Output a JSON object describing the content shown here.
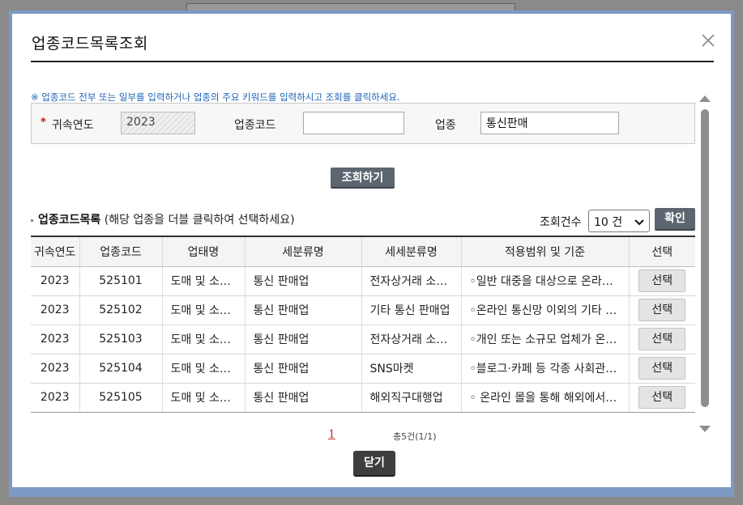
{
  "modal": {
    "title": "업종코드목록조회",
    "close_icon": "close-icon",
    "notice": "※ 업종코드 전부 또는 일부를 입력하거나 업종의 주요 키워드를 입력하시고 조회를 클릭하세요.",
    "search": {
      "required_mark": "*",
      "year_label": "귀속연도",
      "year_value": "2023",
      "code_label": "업종코드",
      "code_value": "",
      "industry_label": "업종",
      "industry_value": "통신판매"
    },
    "search_button": "조회하기",
    "list": {
      "title": "업종코드목록",
      "hint": "(해당 업종을 더블 클릭하여 선택하세요)",
      "count_label": "조회건수",
      "count_value": "10 건",
      "confirm_button": "확인"
    },
    "table": {
      "headers": [
        "귀속연도",
        "업종코드",
        "업태명",
        "세분류명",
        "세세분류명",
        "적용범위 및 기준",
        "선택"
      ],
      "rows": [
        {
          "year": "2023",
          "code": "525101",
          "business": "도매 및 소매업",
          "sub": "통신 판매업",
          "subsub": "전자상거래 소매업",
          "scope": "◦일반 대중을 대상으로 온라인 통신망을 통하여",
          "select": "선택"
        },
        {
          "year": "2023",
          "code": "525102",
          "business": "도매 및 소매업",
          "sub": "통신 판매업",
          "subsub": "기타 통신 판매업",
          "scope": "◦온라인 통신망 이외의 기타 통신 수단에 의하여",
          "select": "선택"
        },
        {
          "year": "2023",
          "code": "525103",
          "business": "도매 및 소매업",
          "sub": "통신 판매업",
          "subsub": "전자상거래 소매 중개업",
          "scope": "◦개인 또는 소규모 업체가 온라인으로",
          "select": "선택"
        },
        {
          "year": "2023",
          "code": "525104",
          "business": "도매 및 소매업",
          "sub": "통신 판매업",
          "subsub": "SNS마켓",
          "scope": "◦블로그·카페 등 각종 사회관계망서비스",
          "select": "선택"
        },
        {
          "year": "2023",
          "code": "525105",
          "business": "도매 및 소매업",
          "sub": "통신 판매업",
          "subsub": "해외직구대행업",
          "scope": "◦ 온라인 몰을 통해 해외에서 구매를 대행",
          "select": "선택"
        }
      ]
    },
    "pager": {
      "current_page": "1",
      "total_text": "총5건(1/1)"
    },
    "close_button": "닫기"
  },
  "colors": {
    "frame": "#7b9ac4",
    "button_dark": "#5c6670",
    "notice_text": "#1c63b7",
    "required": "#dd1111",
    "page_link": "#c0392b"
  }
}
